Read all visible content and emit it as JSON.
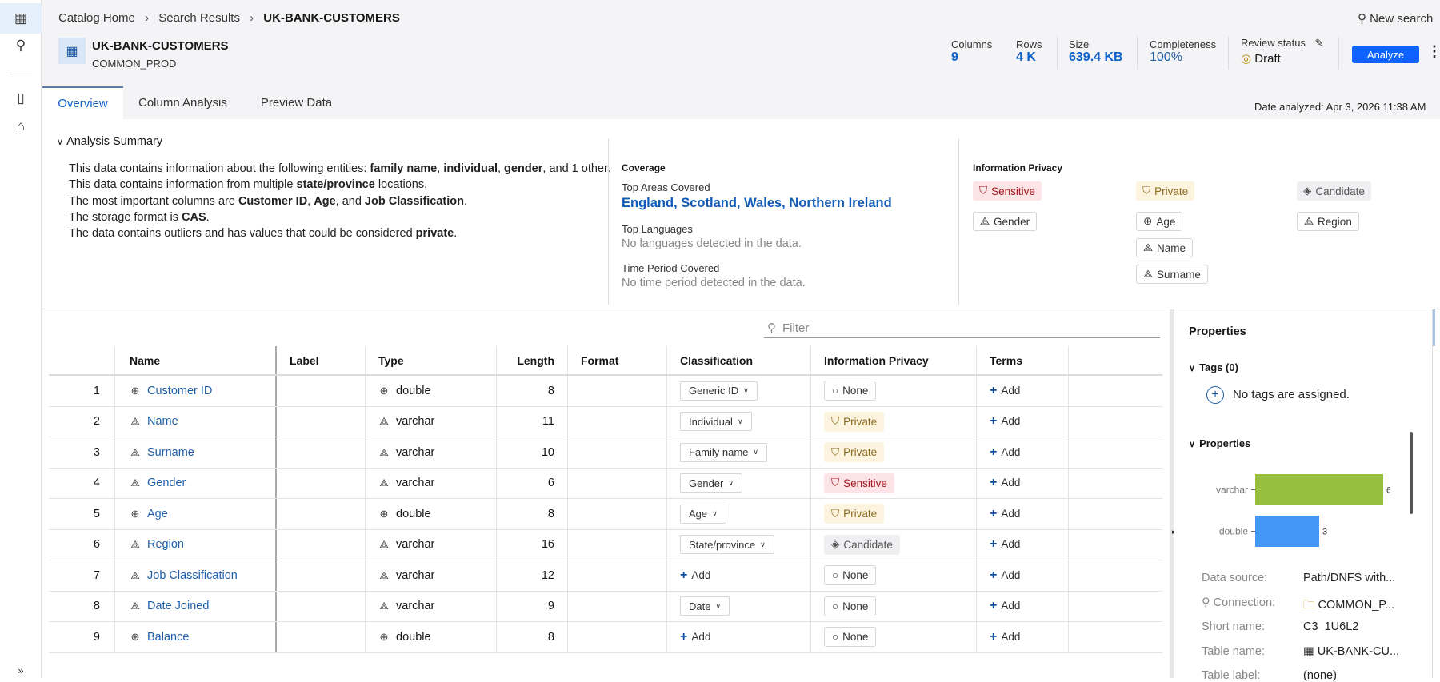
{
  "breadcrumb": {
    "items": [
      "Catalog Home",
      "Search Results"
    ],
    "current": "UK-BANK-CUSTOMERS"
  },
  "header": {
    "title": "UK-BANK-CUSTOMERS",
    "subtitle": "COMMON_PROD",
    "new_search": "New search",
    "stats": [
      {
        "label": "Columns",
        "value": "9"
      },
      {
        "label": "Rows",
        "value": "4 K"
      },
      {
        "label": "Size",
        "value": "639.4 KB"
      },
      {
        "label": "Completeness",
        "value": "100%"
      }
    ],
    "review_status_label": "Review status",
    "review_status_value": "Draft",
    "analyze": "Analyze"
  },
  "tabs": [
    {
      "label": "Overview",
      "active": true
    },
    {
      "label": "Column Analysis"
    },
    {
      "label": "Preview Data"
    }
  ],
  "date_analyzed": "Date analyzed: Apr 3, 2026 11:38 AM",
  "summary": {
    "title": "Analysis Summary",
    "lines_html": [
      "This data contains information about the following entities: <b>family name</b>, <b>individual</b>, <b>gender</b>, and 1 other.",
      "This data contains information from multiple <b>state/province</b> locations.",
      "The most important columns are <b>Customer ID</b>, <b>Age</b>, and <b>Job Classification</b>.",
      "The storage format is <b>CAS</b>.",
      "The data contains outliers and has values that could be considered <b>private</b>."
    ]
  },
  "coverage": {
    "title": "Coverage",
    "areas_label": "Top Areas Covered",
    "areas": "England, Scotland, Wales, Northern Ireland",
    "languages_label": "Top Languages",
    "languages": "No languages detected in the data.",
    "period_label": "Time Period Covered",
    "period": "No time period detected in the data."
  },
  "privacy": {
    "title": "Information Privacy",
    "sensitive": "Sensitive",
    "private": "Private",
    "candidate": "Candidate",
    "sensitive_cols": [
      "Gender"
    ],
    "private_cols": [
      "Age",
      "Name",
      "Surname"
    ],
    "candidate_cols": [
      "Region"
    ]
  },
  "filter_placeholder": "Filter",
  "table": {
    "headers": [
      "",
      "Name",
      "Label",
      "Type",
      "Length",
      "Format",
      "Classification",
      "Information Privacy",
      "Terms"
    ],
    "add": "Add",
    "rows": [
      {
        "n": "1",
        "name": "Customer ID",
        "type": "double",
        "length": "8",
        "class": "Generic ID",
        "privacy": "None",
        "pk": "none"
      },
      {
        "n": "2",
        "name": "Name",
        "type": "varchar",
        "length": "11",
        "class": "Individual",
        "privacy": "Private",
        "pk": "priv"
      },
      {
        "n": "3",
        "name": "Surname",
        "type": "varchar",
        "length": "10",
        "class": "Family name",
        "privacy": "Private",
        "pk": "priv"
      },
      {
        "n": "4",
        "name": "Gender",
        "type": "varchar",
        "length": "6",
        "class": "Gender",
        "privacy": "Sensitive",
        "pk": "sens"
      },
      {
        "n": "5",
        "name": "Age",
        "type": "double",
        "length": "8",
        "class": "Age",
        "privacy": "Private",
        "pk": "priv"
      },
      {
        "n": "6",
        "name": "Region",
        "type": "varchar",
        "length": "16",
        "class": "State/province",
        "privacy": "Candidate",
        "pk": "cand"
      },
      {
        "n": "7",
        "name": "Job Classification",
        "type": "varchar",
        "length": "12",
        "class": "",
        "privacy": "None",
        "pk": "none"
      },
      {
        "n": "8",
        "name": "Date Joined",
        "type": "varchar",
        "length": "9",
        "class": "Date",
        "privacy": "None",
        "pk": "none"
      },
      {
        "n": "9",
        "name": "Balance",
        "type": "double",
        "length": "8",
        "class": "",
        "privacy": "None",
        "pk": "none"
      }
    ]
  },
  "properties": {
    "title": "Properties",
    "tags_title": "Tags (0)",
    "no_tags": "No tags are assigned.",
    "props_title": "Properties",
    "fields": [
      {
        "label": "Data source:",
        "value": "Path/DNFS with..."
      },
      {
        "label": "Connection:",
        "value": "COMMON_P..."
      },
      {
        "label": "Short name:",
        "value": "C3_1U6L2"
      },
      {
        "label": "Table name:",
        "value": "UK-BANK-CU..."
      },
      {
        "label": "Table label:",
        "value": "(none)"
      }
    ]
  },
  "chart_data": {
    "type": "bar",
    "orientation": "horizontal",
    "categories": [
      "varchar",
      "double"
    ],
    "values": [
      6,
      3
    ],
    "colors": [
      "#97be3f",
      "#4496f7"
    ],
    "xlim": [
      0,
      6
    ]
  }
}
